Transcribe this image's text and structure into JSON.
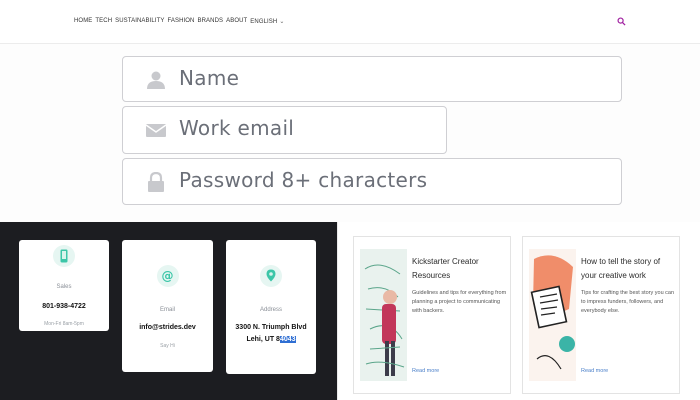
{
  "nav": {
    "items": [
      "HOME",
      "TECH",
      "SUSTAINABILITY",
      "FASHION",
      "BRANDS",
      "ABOUT",
      "ENGLISH"
    ],
    "accent": "#a020a0"
  },
  "form": {
    "name_placeholder": "Name",
    "email_placeholder": "Work email",
    "password_placeholder": "Password 8+ characters"
  },
  "contacts": [
    {
      "label": "Sales",
      "value": "801-938-4722",
      "sub": "Mon-Fri 8am-5pm"
    },
    {
      "label": "Email",
      "value": "info@strides.dev",
      "sub": "Say Hi"
    },
    {
      "label": "Address",
      "value_line1": "3300 N. Triumph Blvd",
      "value_line2_pre": "Lehi, UT 8",
      "value_line2_hl": "4043"
    }
  ],
  "resources": [
    {
      "title": "Kickstarter Creator Resources",
      "description": "Guidelines and tips for everything from planning a project to communicating with backers.",
      "link": "Read more"
    },
    {
      "title": "How to tell the story of your creative work",
      "description": "Tips for crafting the best story you can to impress funders, followers, and everybody else.",
      "link": "Read more"
    }
  ],
  "colors": {
    "dark_panel": "#1c1d21",
    "icon_green": "#3cc6a8",
    "highlight": "#2f6fd3"
  }
}
